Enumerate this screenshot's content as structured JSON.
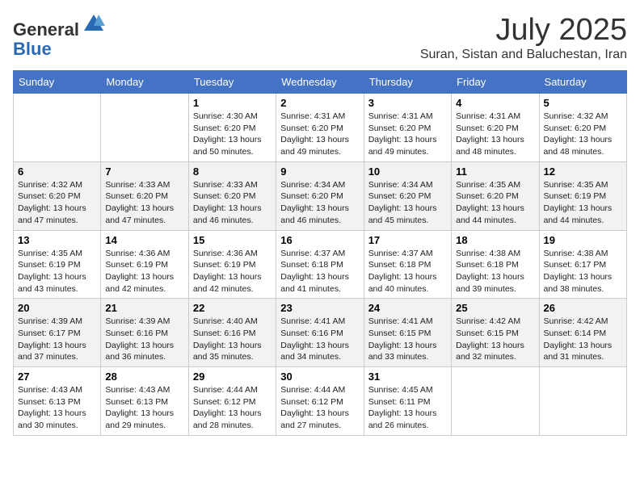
{
  "logo": {
    "general": "General",
    "blue": "Blue"
  },
  "title": "July 2025",
  "location": "Suran, Sistan and Baluchestan, Iran",
  "days_of_week": [
    "Sunday",
    "Monday",
    "Tuesday",
    "Wednesday",
    "Thursday",
    "Friday",
    "Saturday"
  ],
  "weeks": [
    [
      {
        "day": "",
        "info": ""
      },
      {
        "day": "",
        "info": ""
      },
      {
        "day": "1",
        "info": "Sunrise: 4:30 AM\nSunset: 6:20 PM\nDaylight: 13 hours and 50 minutes."
      },
      {
        "day": "2",
        "info": "Sunrise: 4:31 AM\nSunset: 6:20 PM\nDaylight: 13 hours and 49 minutes."
      },
      {
        "day": "3",
        "info": "Sunrise: 4:31 AM\nSunset: 6:20 PM\nDaylight: 13 hours and 49 minutes."
      },
      {
        "day": "4",
        "info": "Sunrise: 4:31 AM\nSunset: 6:20 PM\nDaylight: 13 hours and 48 minutes."
      },
      {
        "day": "5",
        "info": "Sunrise: 4:32 AM\nSunset: 6:20 PM\nDaylight: 13 hours and 48 minutes."
      }
    ],
    [
      {
        "day": "6",
        "info": "Sunrise: 4:32 AM\nSunset: 6:20 PM\nDaylight: 13 hours and 47 minutes."
      },
      {
        "day": "7",
        "info": "Sunrise: 4:33 AM\nSunset: 6:20 PM\nDaylight: 13 hours and 47 minutes."
      },
      {
        "day": "8",
        "info": "Sunrise: 4:33 AM\nSunset: 6:20 PM\nDaylight: 13 hours and 46 minutes."
      },
      {
        "day": "9",
        "info": "Sunrise: 4:34 AM\nSunset: 6:20 PM\nDaylight: 13 hours and 46 minutes."
      },
      {
        "day": "10",
        "info": "Sunrise: 4:34 AM\nSunset: 6:20 PM\nDaylight: 13 hours and 45 minutes."
      },
      {
        "day": "11",
        "info": "Sunrise: 4:35 AM\nSunset: 6:20 PM\nDaylight: 13 hours and 44 minutes."
      },
      {
        "day": "12",
        "info": "Sunrise: 4:35 AM\nSunset: 6:19 PM\nDaylight: 13 hours and 44 minutes."
      }
    ],
    [
      {
        "day": "13",
        "info": "Sunrise: 4:35 AM\nSunset: 6:19 PM\nDaylight: 13 hours and 43 minutes."
      },
      {
        "day": "14",
        "info": "Sunrise: 4:36 AM\nSunset: 6:19 PM\nDaylight: 13 hours and 42 minutes."
      },
      {
        "day": "15",
        "info": "Sunrise: 4:36 AM\nSunset: 6:19 PM\nDaylight: 13 hours and 42 minutes."
      },
      {
        "day": "16",
        "info": "Sunrise: 4:37 AM\nSunset: 6:18 PM\nDaylight: 13 hours and 41 minutes."
      },
      {
        "day": "17",
        "info": "Sunrise: 4:37 AM\nSunset: 6:18 PM\nDaylight: 13 hours and 40 minutes."
      },
      {
        "day": "18",
        "info": "Sunrise: 4:38 AM\nSunset: 6:18 PM\nDaylight: 13 hours and 39 minutes."
      },
      {
        "day": "19",
        "info": "Sunrise: 4:38 AM\nSunset: 6:17 PM\nDaylight: 13 hours and 38 minutes."
      }
    ],
    [
      {
        "day": "20",
        "info": "Sunrise: 4:39 AM\nSunset: 6:17 PM\nDaylight: 13 hours and 37 minutes."
      },
      {
        "day": "21",
        "info": "Sunrise: 4:39 AM\nSunset: 6:16 PM\nDaylight: 13 hours and 36 minutes."
      },
      {
        "day": "22",
        "info": "Sunrise: 4:40 AM\nSunset: 6:16 PM\nDaylight: 13 hours and 35 minutes."
      },
      {
        "day": "23",
        "info": "Sunrise: 4:41 AM\nSunset: 6:16 PM\nDaylight: 13 hours and 34 minutes."
      },
      {
        "day": "24",
        "info": "Sunrise: 4:41 AM\nSunset: 6:15 PM\nDaylight: 13 hours and 33 minutes."
      },
      {
        "day": "25",
        "info": "Sunrise: 4:42 AM\nSunset: 6:15 PM\nDaylight: 13 hours and 32 minutes."
      },
      {
        "day": "26",
        "info": "Sunrise: 4:42 AM\nSunset: 6:14 PM\nDaylight: 13 hours and 31 minutes."
      }
    ],
    [
      {
        "day": "27",
        "info": "Sunrise: 4:43 AM\nSunset: 6:13 PM\nDaylight: 13 hours and 30 minutes."
      },
      {
        "day": "28",
        "info": "Sunrise: 4:43 AM\nSunset: 6:13 PM\nDaylight: 13 hours and 29 minutes."
      },
      {
        "day": "29",
        "info": "Sunrise: 4:44 AM\nSunset: 6:12 PM\nDaylight: 13 hours and 28 minutes."
      },
      {
        "day": "30",
        "info": "Sunrise: 4:44 AM\nSunset: 6:12 PM\nDaylight: 13 hours and 27 minutes."
      },
      {
        "day": "31",
        "info": "Sunrise: 4:45 AM\nSunset: 6:11 PM\nDaylight: 13 hours and 26 minutes."
      },
      {
        "day": "",
        "info": ""
      },
      {
        "day": "",
        "info": ""
      }
    ]
  ]
}
